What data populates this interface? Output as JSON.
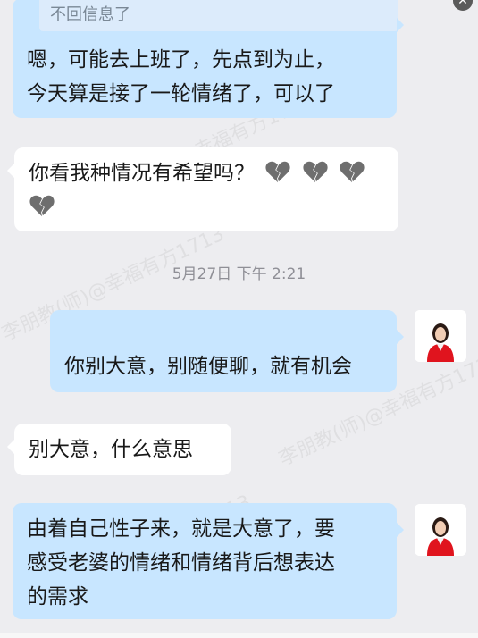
{
  "watermark": {
    "text_a": "李朋教(师)@幸福有方1713",
    "text_b": "李朋教(师)@幸福有方1713",
    "text_c": "李朋教(师)@幸福有方1713",
    "text_d": "李朋教(师)@幸福有方1713"
  },
  "chat": {
    "quote_text": "不回信息了",
    "messages": [
      {
        "side": "right",
        "lines": [
          "嗯，可能去上班了，先点到为止，",
          "今天算是接了一轮情绪了，可以了"
        ]
      },
      {
        "side": "left",
        "lines": [
          "你看我种情况有希望吗？"
        ],
        "emoji": "broken-heart"
      },
      {
        "side": "right",
        "lines": [
          "你别大意，别随便聊，就有机会"
        ]
      },
      {
        "side": "left",
        "lines": [
          "别大意，什么意思"
        ]
      },
      {
        "side": "right",
        "lines": [
          "由着自己性子来，就是大意了，要",
          "感受老婆的情绪和情绪背后想表达",
          "的需求"
        ]
      }
    ],
    "timestamp": "5月27日  下午 2:21"
  },
  "colors": {
    "background": "#ededf0",
    "bubble_left": "#ffffff",
    "bubble_right": "#c8e6ff",
    "quote_bg": "#dcebfb"
  }
}
